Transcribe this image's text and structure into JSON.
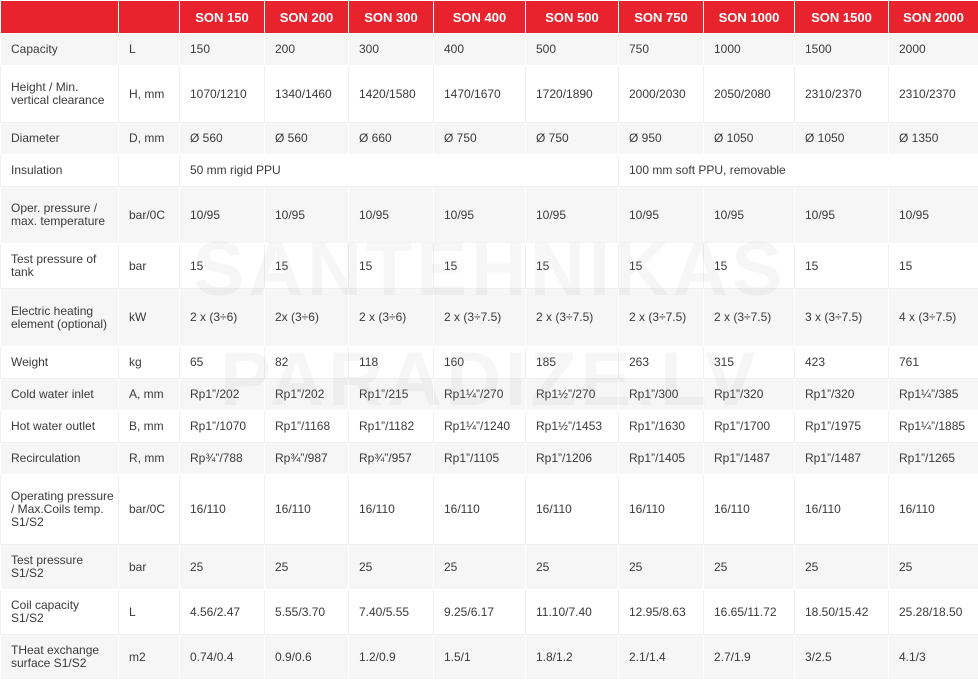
{
  "columns": [
    "SON 150",
    "SON 200",
    "SON 300",
    "SON 400",
    "SON 500",
    "SON 750",
    "SON 1000",
    "SON 1500",
    "SON 2000"
  ],
  "watermark": {
    "line1": "SANTEHNIKAS",
    "line2": "PARADIZE.LV"
  },
  "colors": {
    "header_bg": "#e8232e",
    "header_text": "#ffffff",
    "stripe": "#f6f6f6",
    "text": "#3a3a3a"
  },
  "rows": [
    {
      "param": "Capacity",
      "unit": "L",
      "values": [
        "150",
        "200",
        "300",
        "400",
        "500",
        "750",
        "1000",
        "1500",
        "2000"
      ]
    },
    {
      "param": "Height  / Min. vertical clearance",
      "unit": "H, mm",
      "values": [
        "1070/1210",
        "1340/1460",
        "1420/1580",
        "1470/1670",
        "1720/1890",
        "2000/2030",
        "2050/2080",
        "2310/2370",
        "2310/2370"
      ]
    },
    {
      "param": "Diameter",
      "unit": "D, mm",
      "values": [
        "Ø 560",
        "Ø 560",
        "Ø 660",
        "Ø 750",
        "Ø 750",
        "Ø 950",
        "Ø 1050",
        "Ø 1050",
        "Ø 1350"
      ]
    },
    {
      "param": "Insulation",
      "unit": "",
      "span_left": "50 mm rigid PPU",
      "span_right": "100 mm soft PPU, removable"
    },
    {
      "param": "Oper. pressure / max. temperature",
      "unit": "bar/0C",
      "values": [
        "10/95",
        "10/95",
        "10/95",
        "10/95",
        "10/95",
        "10/95",
        "10/95",
        "10/95",
        "10/95"
      ]
    },
    {
      "param": "Test pressure of tank",
      "unit": "bar",
      "values": [
        "15",
        "15",
        "15",
        "15",
        "15",
        "15",
        "15",
        "15",
        "15"
      ]
    },
    {
      "param": "Electric heating element (optional)",
      "unit": "kW",
      "values": [
        "2 x (3÷6)",
        "2x (3÷6)",
        "2 x (3÷6)",
        "2 x (3÷7.5)",
        "2 x (3÷7.5)",
        "2 x (3÷7.5)",
        "2 x  (3÷7.5)",
        "3 x (3÷7.5)",
        "4 x (3÷7.5)"
      ]
    },
    {
      "param": "Weight",
      "unit": "kg",
      "values": [
        "65",
        "82",
        "118",
        "160",
        "185",
        "263",
        "315",
        "423",
        "761"
      ]
    },
    {
      "param": "Cold water inlet",
      "unit": "A, mm",
      "values": [
        "Rp1”/202",
        "Rp1”/202",
        "Rp1”/215",
        "Rp1¼”/270",
        "Rp1½”/270",
        "Rp1”/300",
        "Rp1”/320",
        "Rp1”/320",
        "Rp1¼”/385"
      ]
    },
    {
      "param": "Hot water outlet",
      "unit": "B, mm",
      "values": [
        "Rp1”/1070",
        "Rp1”/1168",
        "Rp1”/1182",
        "Rp1¼”/1240",
        "Rp1½”/1453",
        "Rp1”/1630",
        "Rp1”/1700",
        "Rp1”/1975",
        "Rp1¼”/1885"
      ]
    },
    {
      "param": "Recirculation",
      "unit": "R, mm",
      "values": [
        "Rp¾”/788",
        "Rp¾”/987",
        "Rp¾”/957",
        "Rp1”/1105",
        "Rp1”/1206",
        "Rp1”/1405",
        "Rp1”/1487",
        "Rp1”/1487",
        "Rp1”/1265"
      ]
    },
    {
      "param": "Operating pressure / Max.Coils temp. S1/S2",
      "unit": "bar/0C",
      "values": [
        "16/110",
        "16/110",
        "16/110",
        "16/110",
        "16/110",
        "16/110",
        "16/110",
        "16/110",
        "16/110"
      ]
    },
    {
      "param": "Test pressure S1/S2",
      "unit": "bar",
      "values": [
        "25",
        "25",
        "25",
        "25",
        "25",
        "25",
        "25",
        "25",
        "25"
      ]
    },
    {
      "param": "Coil capacity S1/S2",
      "unit": "L",
      "values": [
        "4.56/2.47",
        "5.55/3.70",
        "7.40/5.55",
        "9.25/6.17",
        "11.10/7.40",
        "12.95/8.63",
        "16.65/11.72",
        "18.50/15.42",
        "25.28/18.50"
      ]
    },
    {
      "param": "THeat exchange surface   S1/S2",
      "unit": "m2",
      "values": [
        "0.74/0.4",
        "0.9/0.6",
        "1.2/0.9",
        "1.5/1",
        "1.8/1.2",
        "2.1/1.4",
        "2.7/1.9",
        "3/2.5",
        "4.1/3"
      ]
    }
  ]
}
